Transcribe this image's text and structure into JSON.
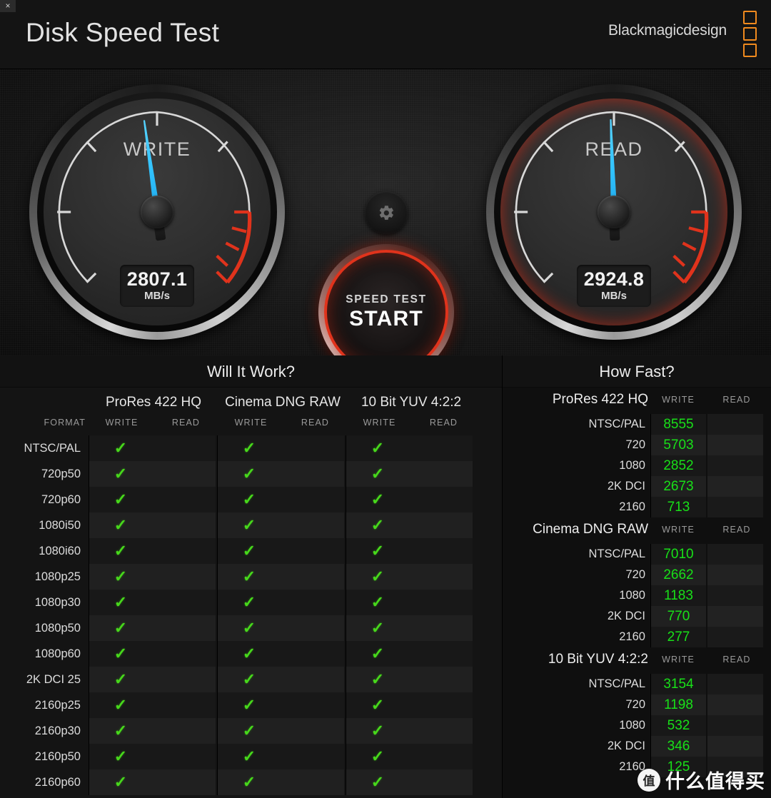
{
  "window": {
    "close_label": "×"
  },
  "header": {
    "title": "Disk Speed Test",
    "brand": "Blackmagicdesign",
    "logo_icon": "blackmagic-squares-icon",
    "accent_orange": "#f08a1e"
  },
  "gauges": {
    "write": {
      "label": "WRITE",
      "value": "2807.1",
      "unit": "MB/s",
      "needle_angle": -8,
      "glow": false
    },
    "read": {
      "label": "READ",
      "value": "2924.8",
      "unit": "MB/s",
      "needle_angle": -2,
      "glow": true,
      "glow_color": "#e02a14"
    },
    "needle_color": "#31c2ff",
    "redzone_color": "#e0331c"
  },
  "start_button": {
    "small_label": "SPEED TEST",
    "big_label": "START",
    "ring_color": "#e0331c",
    "gear_icon": "gear-icon"
  },
  "will_it_work": {
    "title": "Will It Work?",
    "format_label": "FORMAT",
    "groups": [
      "ProRes 422 HQ",
      "Cinema DNG RAW",
      "10 Bit YUV 4:2:2"
    ],
    "sub_columns": [
      "WRITE",
      "READ"
    ],
    "check_glyph": "✓",
    "check_color": "#47d81b",
    "rows": [
      {
        "format": "NTSC/PAL",
        "cells": [
          true,
          false,
          true,
          false,
          true,
          false
        ]
      },
      {
        "format": "720p50",
        "cells": [
          true,
          false,
          true,
          false,
          true,
          false
        ]
      },
      {
        "format": "720p60",
        "cells": [
          true,
          false,
          true,
          false,
          true,
          false
        ]
      },
      {
        "format": "1080i50",
        "cells": [
          true,
          false,
          true,
          false,
          true,
          false
        ]
      },
      {
        "format": "1080i60",
        "cells": [
          true,
          false,
          true,
          false,
          true,
          false
        ]
      },
      {
        "format": "1080p25",
        "cells": [
          true,
          false,
          true,
          false,
          true,
          false
        ]
      },
      {
        "format": "1080p30",
        "cells": [
          true,
          false,
          true,
          false,
          true,
          false
        ]
      },
      {
        "format": "1080p50",
        "cells": [
          true,
          false,
          true,
          false,
          true,
          false
        ]
      },
      {
        "format": "1080p60",
        "cells": [
          true,
          false,
          true,
          false,
          true,
          false
        ]
      },
      {
        "format": "2K DCI 25",
        "cells": [
          true,
          false,
          true,
          false,
          true,
          false
        ]
      },
      {
        "format": "2160p25",
        "cells": [
          true,
          false,
          true,
          false,
          true,
          false
        ]
      },
      {
        "format": "2160p30",
        "cells": [
          true,
          false,
          true,
          false,
          true,
          false
        ]
      },
      {
        "format": "2160p50",
        "cells": [
          true,
          false,
          true,
          false,
          true,
          false
        ]
      },
      {
        "format": "2160p60",
        "cells": [
          true,
          false,
          true,
          false,
          true,
          false
        ]
      }
    ]
  },
  "how_fast": {
    "title": "How Fast?",
    "sub_columns": [
      "WRITE",
      "READ"
    ],
    "value_color": "#18e018",
    "sections": [
      {
        "name": "ProRes 422 HQ",
        "rows": [
          {
            "label": "NTSC/PAL",
            "write": "8555",
            "read": ""
          },
          {
            "label": "720",
            "write": "5703",
            "read": ""
          },
          {
            "label": "1080",
            "write": "2852",
            "read": ""
          },
          {
            "label": "2K DCI",
            "write": "2673",
            "read": ""
          },
          {
            "label": "2160",
            "write": "713",
            "read": ""
          }
        ]
      },
      {
        "name": "Cinema DNG RAW",
        "rows": [
          {
            "label": "NTSC/PAL",
            "write": "7010",
            "read": ""
          },
          {
            "label": "720",
            "write": "2662",
            "read": ""
          },
          {
            "label": "1080",
            "write": "1183",
            "read": ""
          },
          {
            "label": "2K DCI",
            "write": "770",
            "read": ""
          },
          {
            "label": "2160",
            "write": "277",
            "read": ""
          }
        ]
      },
      {
        "name": "10 Bit YUV 4:2:2",
        "rows": [
          {
            "label": "NTSC/PAL",
            "write": "3154",
            "read": ""
          },
          {
            "label": "720",
            "write": "1198",
            "read": ""
          },
          {
            "label": "1080",
            "write": "532",
            "read": ""
          },
          {
            "label": "2K DCI",
            "write": "346",
            "read": ""
          },
          {
            "label": "2160",
            "write": "125",
            "read": ""
          }
        ]
      }
    ]
  },
  "watermark": {
    "badge": "值",
    "text": "什么值得买"
  }
}
